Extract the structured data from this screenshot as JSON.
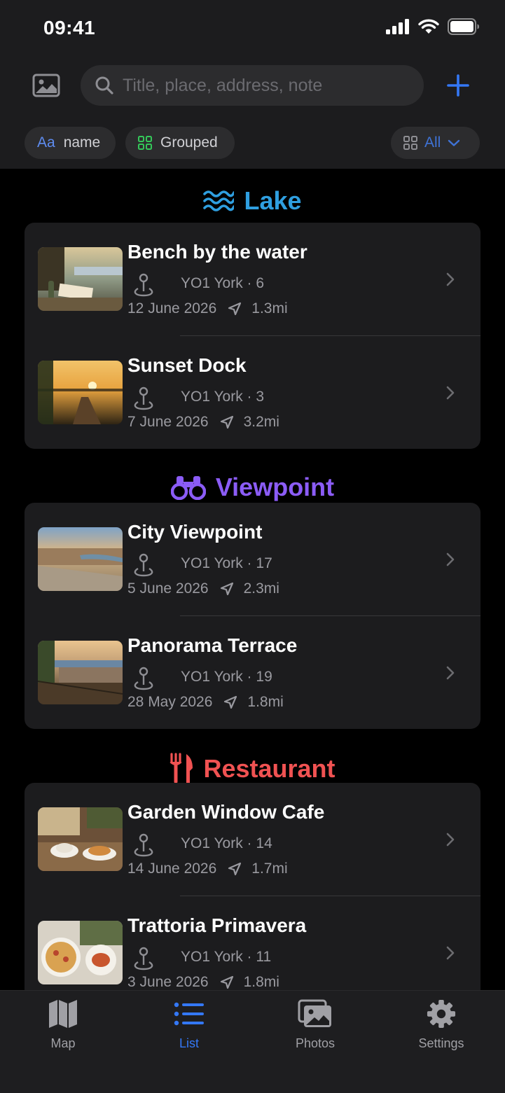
{
  "status_bar": {
    "time": "09:41"
  },
  "search": {
    "placeholder": "Title, place, address, note"
  },
  "filters": {
    "sort_icon_text": "Aa",
    "sort_label": "name",
    "group_label": "Grouped",
    "category_label": "All"
  },
  "colors": {
    "accent": "#3478f6",
    "lake": "#2f9fe0",
    "viewpoint": "#8b5cf6",
    "restaurant": "#f05252"
  },
  "sections": [
    {
      "title": "Lake",
      "icon": "waves-icon",
      "items": [
        {
          "title": "Bench by the water",
          "address": "YO1 York · 6",
          "date": "12 June 2026",
          "distance": "1.3mi"
        },
        {
          "title": "Sunset Dock",
          "address": "YO1 York · 3",
          "date": "7 June 2026",
          "distance": "3.2mi"
        }
      ]
    },
    {
      "title": "Viewpoint",
      "icon": "binoculars-icon",
      "items": [
        {
          "title": "City Viewpoint",
          "address": "YO1 York · 17",
          "date": "5 June 2026",
          "distance": "2.3mi"
        },
        {
          "title": "Panorama Terrace",
          "address": "YO1 York · 19",
          "date": "28 May 2026",
          "distance": "1.8mi"
        }
      ]
    },
    {
      "title": "Restaurant",
      "icon": "fork-knife-icon",
      "items": [
        {
          "title": "Garden Window Cafe",
          "address": "YO1 York · 14",
          "date": "14 June 2026",
          "distance": "1.7mi"
        },
        {
          "title": "Trattoria Primavera",
          "address": "YO1 York · 11",
          "date": "3 June 2026",
          "distance": "1.8mi"
        }
      ]
    }
  ],
  "tabs": [
    {
      "label": "Map",
      "icon": "map-icon",
      "active": false
    },
    {
      "label": "List",
      "icon": "list-icon",
      "active": true
    },
    {
      "label": "Photos",
      "icon": "photos-icon",
      "active": false
    },
    {
      "label": "Settings",
      "icon": "gear-icon",
      "active": false
    }
  ]
}
